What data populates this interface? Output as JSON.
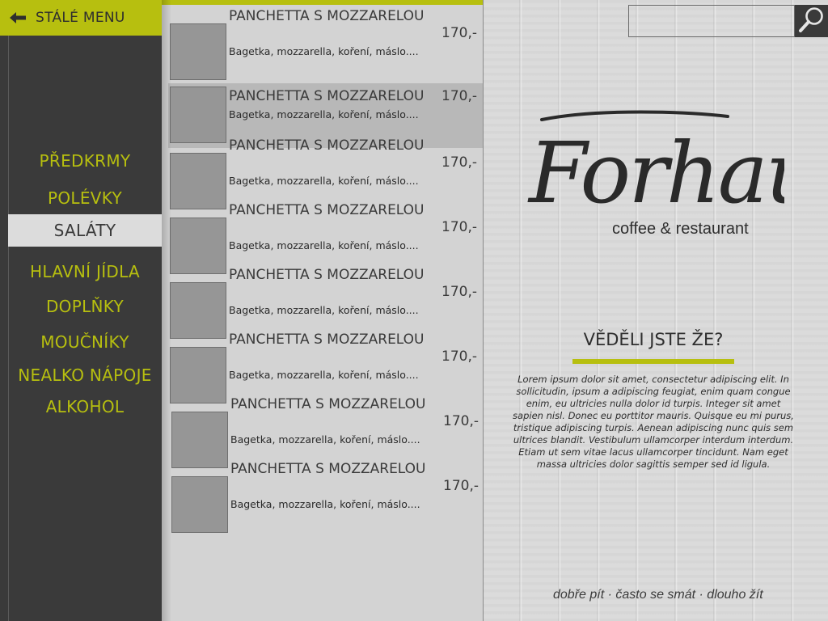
{
  "header": {
    "back_label": "STÁLÉ MENU"
  },
  "nav": {
    "items": [
      {
        "label": "PŘEDKRMY",
        "active": false
      },
      {
        "label": "POLÉVKY",
        "active": false
      },
      {
        "label": "SALÁTY",
        "active": true
      },
      {
        "label": "HLAVNÍ JÍDLA",
        "active": false
      },
      {
        "label": "DOPLŇKY",
        "active": false
      },
      {
        "label": "MOUČNÍKY",
        "active": false
      },
      {
        "label": "NEALKO NÁPOJE",
        "active": false
      },
      {
        "label": "ALKOHOL",
        "active": false
      }
    ]
  },
  "products": [
    {
      "name": "PANCHETTA S MOZZARELOU",
      "desc": "Bagetka, mozzarella, koření, máslo....",
      "price": "170,-",
      "highlight": false
    },
    {
      "name": "PANCHETTA S MOZZARELOU",
      "desc": "Bagetka, mozzarella, koření, máslo....",
      "price": "170,-",
      "highlight": true
    },
    {
      "name": "PANCHETTA S MOZZARELOU",
      "desc": "Bagetka, mozzarella, koření, máslo....",
      "price": "170,-",
      "highlight": false
    },
    {
      "name": "PANCHETTA S MOZZARELOU",
      "desc": "Bagetka, mozzarella, koření, máslo....",
      "price": "170,-",
      "highlight": false
    },
    {
      "name": "PANCHETTA S MOZZARELOU",
      "desc": "Bagetka, mozzarella, koření, máslo....",
      "price": "170,-",
      "highlight": false
    },
    {
      "name": "PANCHETTA S MOZZARELOU",
      "desc": "Bagetka, mozzarella, koření, máslo....",
      "price": "170,-",
      "highlight": false
    },
    {
      "name": "PANCHETTA S MOZZARELOU",
      "desc": "Bagetka, mozzarella, koření, máslo....",
      "price": "170,-",
      "highlight": false
    },
    {
      "name": "PANCHETTA S MOZZARELOU",
      "desc": "Bagetka, mozzarella, koření, máslo....",
      "price": "170,-",
      "highlight": false
    }
  ],
  "search": {
    "placeholder": "",
    "icon": "magnifier-icon"
  },
  "brand": {
    "logo_text": "Forhaus",
    "tagline": "coffee & restaurant"
  },
  "info": {
    "title": "VĚDĚLI JSTE ŽE?",
    "body": "Lorem ipsum dolor sit amet, consectetur adipiscing elit. In sollicitudin, ipsum a adipiscing feugiat, enim quam congue enim, eu ultricies nulla dolor id turpis. Integer sit amet sapien nisl. Donec eu porttitor mauris. Quisque eu mi purus, tristique adipiscing turpis. Aenean adipiscing nunc quis sem ultrices blandit. Vestibulum ullamcorper interdum interdum. Etiam ut sem vitae lacus ullamcorper tincidunt. Nam eget massa ultricies dolor sagittis semper sed id ligula."
  },
  "footer": {
    "motto": "dobře pít · často se smát · dlouho žít"
  },
  "colors": {
    "accent": "#b7bf0f",
    "sidebar_bg": "#3a3a3a",
    "list_bg": "#d3d3d3",
    "highlight_row": "#b8b8b8",
    "active_nav_bg": "#dcdcdc"
  }
}
